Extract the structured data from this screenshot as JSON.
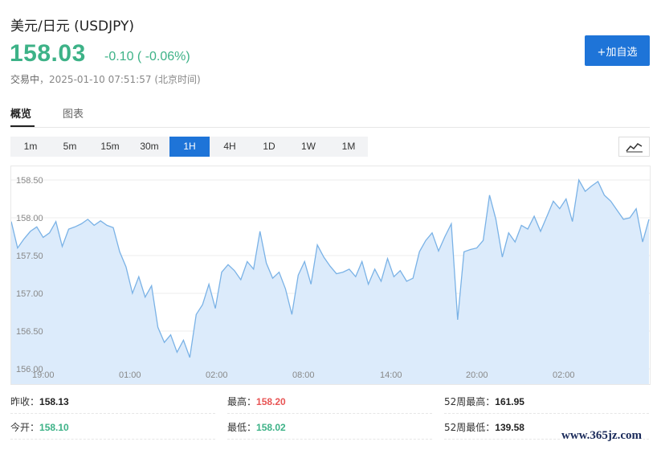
{
  "header": {
    "title": "美元/日元 (USDJPY)",
    "price": "158.03",
    "change": "-0.10 ( -0.06%)",
    "status_label": "交易中",
    "timestamp": "2025-01-10 07:51:57",
    "timezone": "(北京时间)",
    "add_button": "+加自选"
  },
  "tabs": [
    {
      "label": "概览",
      "active": true
    },
    {
      "label": "图表",
      "active": false
    }
  ],
  "periods": [
    {
      "label": "1m"
    },
    {
      "label": "5m"
    },
    {
      "label": "15m"
    },
    {
      "label": "30m"
    },
    {
      "label": "1H",
      "active": true
    },
    {
      "label": "4H"
    },
    {
      "label": "1D"
    },
    {
      "label": "1W"
    },
    {
      "label": "1M"
    }
  ],
  "chart_type_icon": "line-chart-icon",
  "colors": {
    "up_green": "#3db287",
    "down_red": "#e85454",
    "accent_blue": "#1e74d8",
    "line": "#7ab2e6",
    "area": "#dcebfb"
  },
  "chart_data": {
    "type": "area",
    "yticks": [
      "158.50",
      "158.00",
      "157.50",
      "157.00",
      "156.50",
      "156.00"
    ],
    "xticks": [
      "19:00",
      "01:00",
      "02:00",
      "08:00",
      "14:00",
      "20:00",
      "02:00"
    ],
    "ylim": [
      156.0,
      158.5
    ],
    "grid": true,
    "values": [
      157.95,
      157.6,
      157.72,
      157.82,
      157.88,
      157.74,
      157.8,
      157.95,
      157.62,
      157.85,
      157.88,
      157.92,
      157.98,
      157.9,
      157.96,
      157.9,
      157.87,
      157.55,
      157.35,
      157.0,
      157.22,
      156.95,
      157.1,
      156.55,
      156.35,
      156.45,
      156.22,
      156.38,
      156.15,
      156.72,
      156.85,
      157.12,
      156.8,
      157.28,
      157.38,
      157.3,
      157.18,
      157.42,
      157.32,
      157.82,
      157.4,
      157.2,
      157.28,
      157.06,
      156.72,
      157.24,
      157.42,
      157.12,
      157.64,
      157.48,
      157.36,
      157.26,
      157.28,
      157.32,
      157.22,
      157.42,
      157.12,
      157.32,
      157.16,
      157.46,
      157.22,
      157.3,
      157.16,
      157.2,
      157.55,
      157.7,
      157.8,
      157.56,
      157.75,
      157.92,
      156.65,
      157.55,
      157.58,
      157.6,
      157.7,
      158.3,
      157.98,
      157.48,
      157.8,
      157.68,
      157.9,
      157.85,
      158.02,
      157.82,
      158.02,
      158.22,
      158.12,
      158.25,
      157.95,
      158.5,
      158.35,
      158.42,
      158.48,
      158.3,
      158.22,
      158.1,
      157.98,
      158.0,
      158.12,
      157.68,
      157.98
    ]
  },
  "stats": [
    {
      "label": "昨收：",
      "value": "158.13",
      "color": "dark"
    },
    {
      "label": "最高：",
      "value": "158.20",
      "color": "red"
    },
    {
      "label": "52周最高：",
      "value": "161.95",
      "color": "dark"
    },
    {
      "label": "今开：",
      "value": "158.10",
      "color": "green"
    },
    {
      "label": "最低：",
      "value": "158.02",
      "color": "green"
    },
    {
      "label": "52周最低：",
      "value": "139.58",
      "color": "dark"
    }
  ],
  "watermark": "www.365jz.com"
}
